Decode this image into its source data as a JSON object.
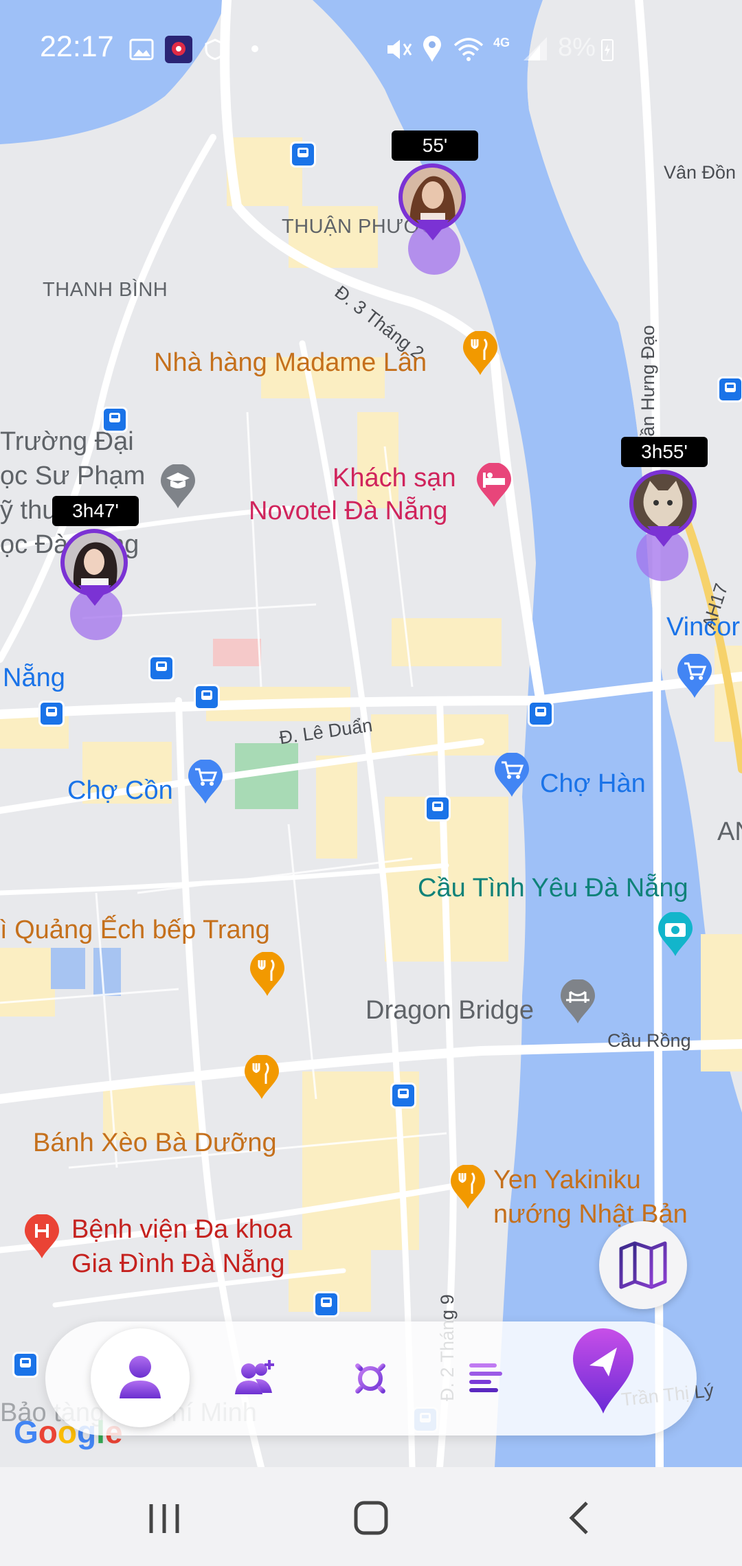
{
  "status_bar": {
    "time": "22:17",
    "network": "4G",
    "battery_text": "8%",
    "icons": [
      "image-icon",
      "app-location-icon",
      "shield-icon",
      "mute-icon",
      "location-icon",
      "wifi-icon",
      "signal-icon",
      "battery-icon"
    ]
  },
  "map": {
    "areas": [
      "THUẬN PHƯỚC",
      "THANH BÌNH"
    ],
    "roads": [
      "Đ. 3 Tháng 2",
      "Đ. Lê Duẩn",
      "Trần Hưng Đạo",
      "AH17",
      "Cầu Rồng",
      "Đ. 2 Tháng 9",
      "Trần Thị Lý",
      "Vân Đồn"
    ],
    "pois": {
      "madame_lan": "Nhà hàng Madame Lân",
      "novotel_l1": "Khách sạn",
      "novotel_l2": "Novotel Đà Nẵng",
      "university_l1": "Trường Đại",
      "university_l2": "ọc Sư Phạm",
      "university_l3": "ỹ thu",
      "university_l3b": "i",
      "university_l4": "ọc Đà",
      "university_l4b": "ng",
      "nang_partial": "Nẵng",
      "cho_con": "Chợ Cồn",
      "cho_han": "Chợ Hàn",
      "vincom_partial": "Vincor",
      "am_partial": "AN",
      "cau_tinh_yeu": "Cầu Tình Yêu Đà Nẵng",
      "mi_quang": "ì Quảng Ếch bếp Trang",
      "dragon_bridge": "Dragon Bridge",
      "banh_xeo": "Bánh Xèo Bà Dưỡng",
      "yakiniku_l1": "Yen Yakiniku",
      "yakiniku_l2": "nướng Nhật Bản",
      "hospital_l1": "Bệnh viện Đa khoa",
      "hospital_l2": "Gia Đình Đà Nẵng",
      "museum_partial": "Bảo tàng Hồ Chí Minh"
    },
    "google_logo": "Google"
  },
  "users": [
    {
      "time_label": "55'"
    },
    {
      "time_label": "3h47'"
    },
    {
      "time_label": "3h55'"
    }
  ],
  "colors": {
    "accent": "#7b32d4",
    "halo": "#a270ec",
    "water": "#9ec0f7",
    "road_fill": "#ffffff",
    "block_fill": "#fbeec2"
  },
  "nav": {
    "items": [
      "profile-icon",
      "add-friend-icon",
      "settings-icon",
      "menu-icon",
      "navigate-icon"
    ],
    "map_toggle": "map-icon"
  },
  "system_nav": [
    "recent-apps-icon",
    "home-icon",
    "back-icon"
  ]
}
